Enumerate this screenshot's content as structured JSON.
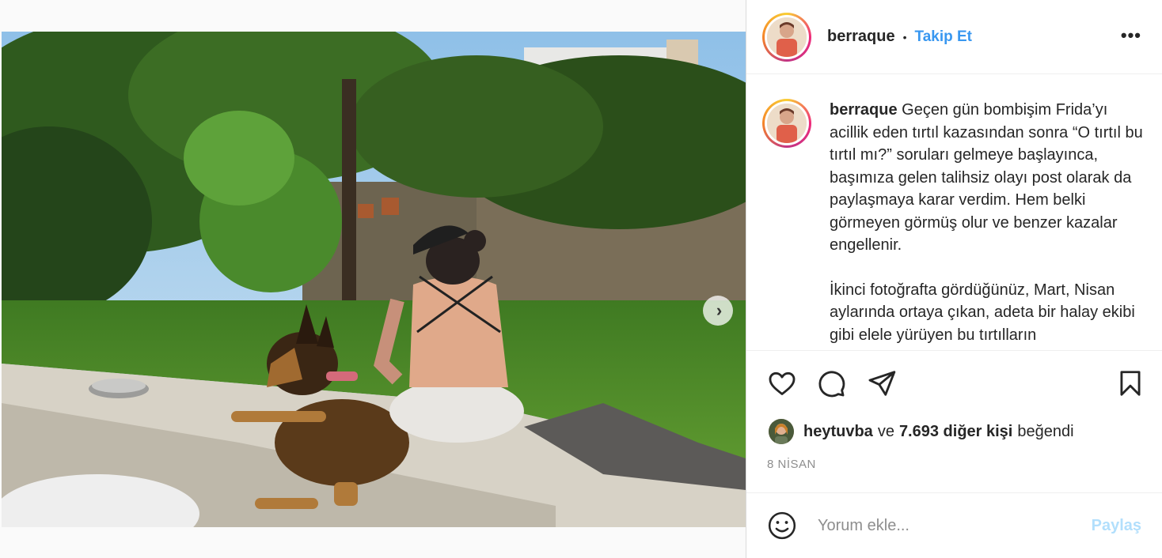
{
  "post": {
    "username": "berraque",
    "separator": "•",
    "follow_label": "Takip Et",
    "more_icon": "more-horizontal-icon",
    "caption_paragraphs": [
      "Geçen gün bombişim Frida’yı acillik eden tırtıl kazasından sonra “O tırtıl bu tırtıl mı?” soruları gelmeye başlayınca, başımıza gelen talihsiz olayı post olarak da paylaşmaya karar verdim. Hem belki görmeyen görmüş olur ve benzer kazalar engellenir.",
      "İkinci fotoğrafta gördüğünüz, Mart, Nisan aylarında ortaya çıkan, adeta bir halay ekibi gibi elele yürüyen bu tırtılların"
    ],
    "likes": {
      "first_liker": "heytuvba",
      "connector": "ve",
      "others": "7.693 diğer kişi",
      "suffix": "beğendi"
    },
    "date": "8 NİSAN",
    "comment": {
      "placeholder": "Yorum ekle...",
      "value": "",
      "post_label": "Paylaş"
    }
  },
  "icons": {
    "like": "heart-icon",
    "comment": "comment-icon",
    "share": "send-icon",
    "save": "bookmark-icon",
    "emoji": "emoji-icon",
    "carousel_next": "chevron-right-icon"
  },
  "colors": {
    "link_blue": "#3897f0",
    "post_disabled": "#b2dffc",
    "muted": "#8e8e8e"
  }
}
